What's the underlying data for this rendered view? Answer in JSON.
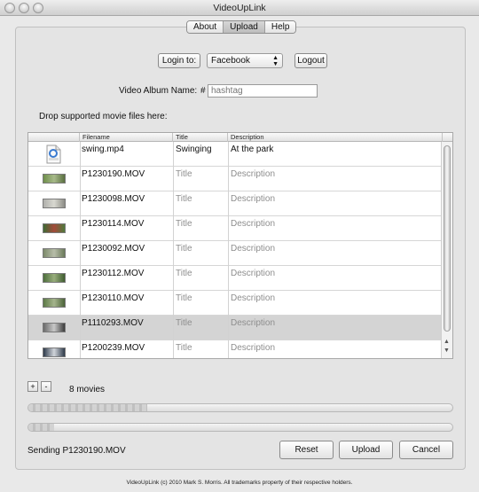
{
  "window": {
    "title": "VideoUpLink"
  },
  "tabs": [
    {
      "label": "About",
      "active": false
    },
    {
      "label": "Upload",
      "active": true
    },
    {
      "label": "Help",
      "active": false
    }
  ],
  "login": {
    "label": "Login to:",
    "service": "Facebook",
    "service_arrows": "▲▼",
    "logout_label": "Logout"
  },
  "album": {
    "label": "Video Album Name:",
    "hash": "#",
    "placeholder": "hashtag"
  },
  "drop_hint": "Drop supported movie files here:",
  "table": {
    "columns": [
      "",
      "Filename",
      "Title",
      "Description"
    ],
    "rows": [
      {
        "icon": "mp4-file-icon",
        "filename": "swing.mp4",
        "title": "Swinging",
        "description": "At the park",
        "placeholder": false,
        "selected": false
      },
      {
        "icon": "video-thumbnail",
        "filename": "P1230190.MOV",
        "title": "Title",
        "description": "Description",
        "placeholder": true,
        "selected": false
      },
      {
        "icon": "video-thumbnail",
        "filename": "P1230098.MOV",
        "title": "Title",
        "description": "Description",
        "placeholder": true,
        "selected": false
      },
      {
        "icon": "video-thumbnail",
        "filename": "P1230114.MOV",
        "title": "Title",
        "description": "Description",
        "placeholder": true,
        "selected": false
      },
      {
        "icon": "video-thumbnail",
        "filename": "P1230092.MOV",
        "title": "Title",
        "description": "Description",
        "placeholder": true,
        "selected": false
      },
      {
        "icon": "video-thumbnail",
        "filename": "P1230112.MOV",
        "title": "Title",
        "description": "Description",
        "placeholder": true,
        "selected": false
      },
      {
        "icon": "video-thumbnail",
        "filename": "P1230110.MOV",
        "title": "Title",
        "description": "Description",
        "placeholder": true,
        "selected": false
      },
      {
        "icon": "video-thumbnail",
        "filename": "P1110293.MOV",
        "title": "Title",
        "description": "Description",
        "placeholder": true,
        "selected": true
      },
      {
        "icon": "video-thumbnail",
        "filename": "P1200239.MOV",
        "title": "Title",
        "description": "Description",
        "placeholder": true,
        "selected": false
      }
    ]
  },
  "controls": {
    "add_label": "+",
    "remove_label": "-",
    "count_text": "8 movies"
  },
  "progress": {
    "overall_fraction": 0.28,
    "current_fraction": 0.06
  },
  "status": {
    "text": "Sending P1230190.MOV"
  },
  "buttons": {
    "reset": "Reset",
    "upload": "Upload",
    "cancel": "Cancel"
  },
  "footer": "VideoUpLink (c) 2010 Mark S. Morris. All trademarks property of their respective holders."
}
